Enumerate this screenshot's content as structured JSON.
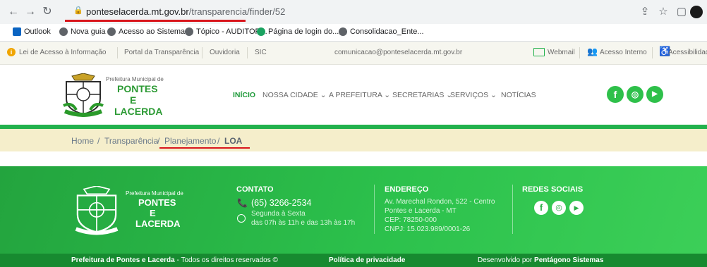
{
  "browser": {
    "url_host": "ponteselacerda.mt.gov.br",
    "url_path": "/transparencia/finder/52",
    "bookmarks": [
      "Outlook",
      "Nova guia",
      "Acesso ao Sistema...",
      "Tópico - AUDITOR...",
      "Página de login do...",
      "Consolidacao_Ente..."
    ]
  },
  "utility": {
    "lai": "Lei de Acesso à Informação",
    "portal": "Portal da Transparência",
    "ouvidoria": "Ouvidoria",
    "sic": "SIC",
    "email": "comunicacao@ponteselacerda.mt.gov.br",
    "webmail": "Webmail",
    "acesso_interno": "Acesso Interno",
    "acessibilidade": "Acessibilidad"
  },
  "header": {
    "logo_prefix": "Prefeitura Municipal de",
    "logo_l1": "PONTES",
    "logo_l2": "E",
    "logo_l3": "LACERDA",
    "menu": [
      "INÍCIO",
      "NOSSA CIDADE",
      "A PREFEITURA",
      "SECRETARIAS",
      "SERVIÇOS",
      "NOTÍCIAS"
    ]
  },
  "breadcrumb": {
    "home": "Home",
    "transparencia": "Transparência",
    "planejamento": "Planejamento",
    "current": "LOA"
  },
  "footer": {
    "contato_title": "CONTATO",
    "phone": "(65) 3266-2534",
    "hours_l1": "Segunda à Sexta",
    "hours_l2": "das 07h às 11h e das 13h às 17h",
    "endereco_title": "ENDEREÇO",
    "addr_l1": "Av. Marechal Rondon, 522 - Centro",
    "addr_l2": "Pontes e Lacerda - MT",
    "addr_l3": "CEP: 78250-000",
    "addr_l4": "CNPJ: 15.023.989/0001-26",
    "redes_title": "REDES SOCIAIS",
    "copyright_bold": "Prefeitura de Pontes e Lacerda",
    "copyright_rest": " - Todos os direitos reservados ©",
    "privacy": "Política de privacidade",
    "dev_prefix": "Desenvolvido por ",
    "dev_name": "Pentágono Sistemas"
  },
  "colors": {
    "accent_green": "#22b14c",
    "highlight_red": "#d9161c"
  }
}
